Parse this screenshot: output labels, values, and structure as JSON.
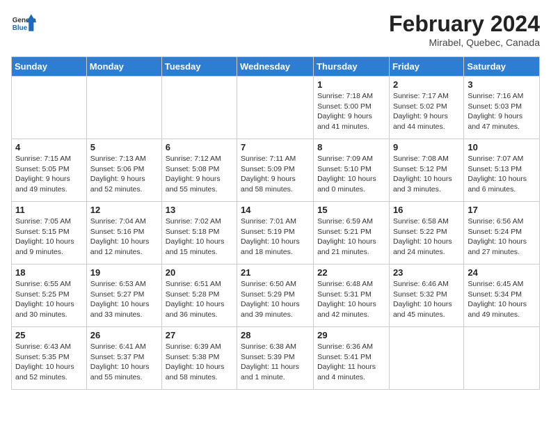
{
  "header": {
    "logo_general": "General",
    "logo_blue": "Blue",
    "month_title": "February 2024",
    "location": "Mirabel, Quebec, Canada"
  },
  "columns": [
    "Sunday",
    "Monday",
    "Tuesday",
    "Wednesday",
    "Thursday",
    "Friday",
    "Saturday"
  ],
  "weeks": [
    [
      {
        "day": "",
        "info": ""
      },
      {
        "day": "",
        "info": ""
      },
      {
        "day": "",
        "info": ""
      },
      {
        "day": "",
        "info": ""
      },
      {
        "day": "1",
        "info": "Sunrise: 7:18 AM\nSunset: 5:00 PM\nDaylight: 9 hours\nand 41 minutes."
      },
      {
        "day": "2",
        "info": "Sunrise: 7:17 AM\nSunset: 5:02 PM\nDaylight: 9 hours\nand 44 minutes."
      },
      {
        "day": "3",
        "info": "Sunrise: 7:16 AM\nSunset: 5:03 PM\nDaylight: 9 hours\nand 47 minutes."
      }
    ],
    [
      {
        "day": "4",
        "info": "Sunrise: 7:15 AM\nSunset: 5:05 PM\nDaylight: 9 hours\nand 49 minutes."
      },
      {
        "day": "5",
        "info": "Sunrise: 7:13 AM\nSunset: 5:06 PM\nDaylight: 9 hours\nand 52 minutes."
      },
      {
        "day": "6",
        "info": "Sunrise: 7:12 AM\nSunset: 5:08 PM\nDaylight: 9 hours\nand 55 minutes."
      },
      {
        "day": "7",
        "info": "Sunrise: 7:11 AM\nSunset: 5:09 PM\nDaylight: 9 hours\nand 58 minutes."
      },
      {
        "day": "8",
        "info": "Sunrise: 7:09 AM\nSunset: 5:10 PM\nDaylight: 10 hours\nand 0 minutes."
      },
      {
        "day": "9",
        "info": "Sunrise: 7:08 AM\nSunset: 5:12 PM\nDaylight: 10 hours\nand 3 minutes."
      },
      {
        "day": "10",
        "info": "Sunrise: 7:07 AM\nSunset: 5:13 PM\nDaylight: 10 hours\nand 6 minutes."
      }
    ],
    [
      {
        "day": "11",
        "info": "Sunrise: 7:05 AM\nSunset: 5:15 PM\nDaylight: 10 hours\nand 9 minutes."
      },
      {
        "day": "12",
        "info": "Sunrise: 7:04 AM\nSunset: 5:16 PM\nDaylight: 10 hours\nand 12 minutes."
      },
      {
        "day": "13",
        "info": "Sunrise: 7:02 AM\nSunset: 5:18 PM\nDaylight: 10 hours\nand 15 minutes."
      },
      {
        "day": "14",
        "info": "Sunrise: 7:01 AM\nSunset: 5:19 PM\nDaylight: 10 hours\nand 18 minutes."
      },
      {
        "day": "15",
        "info": "Sunrise: 6:59 AM\nSunset: 5:21 PM\nDaylight: 10 hours\nand 21 minutes."
      },
      {
        "day": "16",
        "info": "Sunrise: 6:58 AM\nSunset: 5:22 PM\nDaylight: 10 hours\nand 24 minutes."
      },
      {
        "day": "17",
        "info": "Sunrise: 6:56 AM\nSunset: 5:24 PM\nDaylight: 10 hours\nand 27 minutes."
      }
    ],
    [
      {
        "day": "18",
        "info": "Sunrise: 6:55 AM\nSunset: 5:25 PM\nDaylight: 10 hours\nand 30 minutes."
      },
      {
        "day": "19",
        "info": "Sunrise: 6:53 AM\nSunset: 5:27 PM\nDaylight: 10 hours\nand 33 minutes."
      },
      {
        "day": "20",
        "info": "Sunrise: 6:51 AM\nSunset: 5:28 PM\nDaylight: 10 hours\nand 36 minutes."
      },
      {
        "day": "21",
        "info": "Sunrise: 6:50 AM\nSunset: 5:29 PM\nDaylight: 10 hours\nand 39 minutes."
      },
      {
        "day": "22",
        "info": "Sunrise: 6:48 AM\nSunset: 5:31 PM\nDaylight: 10 hours\nand 42 minutes."
      },
      {
        "day": "23",
        "info": "Sunrise: 6:46 AM\nSunset: 5:32 PM\nDaylight: 10 hours\nand 45 minutes."
      },
      {
        "day": "24",
        "info": "Sunrise: 6:45 AM\nSunset: 5:34 PM\nDaylight: 10 hours\nand 49 minutes."
      }
    ],
    [
      {
        "day": "25",
        "info": "Sunrise: 6:43 AM\nSunset: 5:35 PM\nDaylight: 10 hours\nand 52 minutes."
      },
      {
        "day": "26",
        "info": "Sunrise: 6:41 AM\nSunset: 5:37 PM\nDaylight: 10 hours\nand 55 minutes."
      },
      {
        "day": "27",
        "info": "Sunrise: 6:39 AM\nSunset: 5:38 PM\nDaylight: 10 hours\nand 58 minutes."
      },
      {
        "day": "28",
        "info": "Sunrise: 6:38 AM\nSunset: 5:39 PM\nDaylight: 11 hours\nand 1 minute."
      },
      {
        "day": "29",
        "info": "Sunrise: 6:36 AM\nSunset: 5:41 PM\nDaylight: 11 hours\nand 4 minutes."
      },
      {
        "day": "",
        "info": ""
      },
      {
        "day": "",
        "info": ""
      }
    ]
  ]
}
